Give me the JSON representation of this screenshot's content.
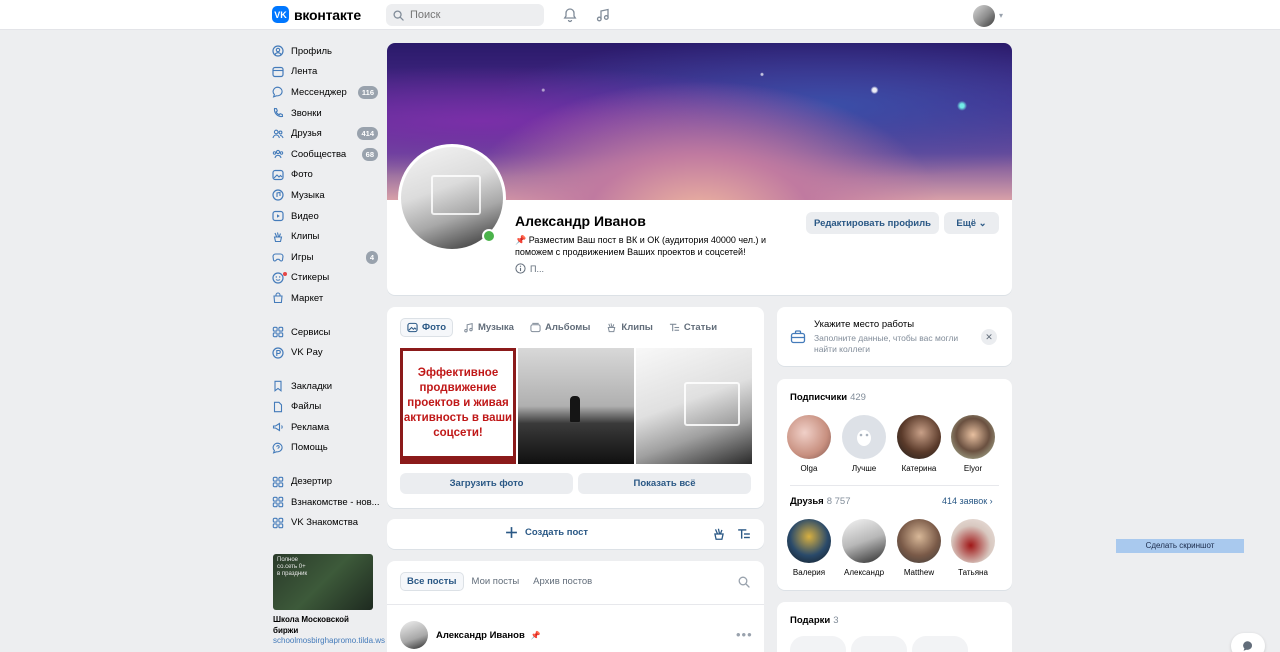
{
  "header": {
    "logo_text": "вконтакте",
    "logo_mark": "VK",
    "search_placeholder": "Поиск"
  },
  "nav": {
    "items": [
      {
        "label": "Профиль",
        "icon": "user-icon"
      },
      {
        "label": "Лента",
        "icon": "feed-icon"
      },
      {
        "label": "Мессенджер",
        "icon": "chat-icon",
        "badge": "116"
      },
      {
        "label": "Звонки",
        "icon": "phone-icon"
      },
      {
        "label": "Друзья",
        "icon": "friends-icon",
        "badge": "414"
      },
      {
        "label": "Сообщества",
        "icon": "communities-icon",
        "badge": "68"
      },
      {
        "label": "Фото",
        "icon": "photo-icon"
      },
      {
        "label": "Музыка",
        "icon": "music-icon"
      },
      {
        "label": "Видео",
        "icon": "video-icon"
      },
      {
        "label": "Клипы",
        "icon": "clips-icon"
      },
      {
        "label": "Игры",
        "icon": "games-icon",
        "badge": "4"
      },
      {
        "label": "Стикеры",
        "icon": "stickers-icon"
      },
      {
        "label": "Маркет",
        "icon": "market-icon"
      },
      {
        "label": "Сервисы",
        "icon": "services-icon"
      },
      {
        "label": "VK Pay",
        "icon": "vkpay-icon"
      },
      {
        "label": "Закладки",
        "icon": "bookmark-icon"
      },
      {
        "label": "Файлы",
        "icon": "file-icon"
      },
      {
        "label": "Реклама",
        "icon": "ads-icon"
      },
      {
        "label": "Помощь",
        "icon": "help-icon"
      },
      {
        "label": "Дезертир",
        "icon": "app-icon"
      },
      {
        "label": "Взнакомстве - нов...",
        "icon": "app-icon"
      },
      {
        "label": "VK Знакомства",
        "icon": "app-icon"
      }
    ]
  },
  "ad": {
    "image_text": "Полное\nсо.сеть 0+\nв праздник",
    "title": "Школа Московской биржи",
    "link": "schoolmosbirghapromo.tilda.ws"
  },
  "profile": {
    "name": "Александр Иванов",
    "status": "📌 Разместим Ваш пост в ВК и ОК (аудитория 40000 чел.) и поможем с продвижением Ваших проектов и соцсетей!",
    "info": "П...",
    "edit_button": "Редактировать профиль",
    "more_button": "Ещё"
  },
  "photos": {
    "tabs": [
      "Фото",
      "Музыка",
      "Альбомы",
      "Клипы",
      "Статьи"
    ],
    "thumb1_text": "Эффективное продвижение проектов и живая активность в ваши соцсети!",
    "upload_button": "Загрузить фото",
    "show_all_button": "Показать всё"
  },
  "create_post": {
    "label": "Создать пост"
  },
  "posts": {
    "tabs": [
      "Все посты",
      "Мои посты",
      "Архив постов"
    ],
    "first_post_author": "Александр Иванов"
  },
  "work": {
    "title": "Укажите место работы",
    "subtitle": "Заполните данные, чтобы вас могли найти коллеги"
  },
  "followers": {
    "title": "Подписчики",
    "count": "429",
    "people": [
      "Olga",
      "Лучше",
      "Катерина",
      "Elyor"
    ]
  },
  "friends": {
    "title": "Друзья",
    "count": "8 757",
    "requests_link": "414 заявок",
    "people": [
      "Валерия",
      "Александр",
      "Matthew",
      "Татьяна"
    ]
  },
  "gifts": {
    "title": "Подарки",
    "count": "3"
  },
  "screenshot_button": "Сделать скриншот",
  "colors": {
    "accent": "#2a5885",
    "brand": "#0077ff",
    "online": "#4bb34b",
    "background": "#edeef0"
  }
}
